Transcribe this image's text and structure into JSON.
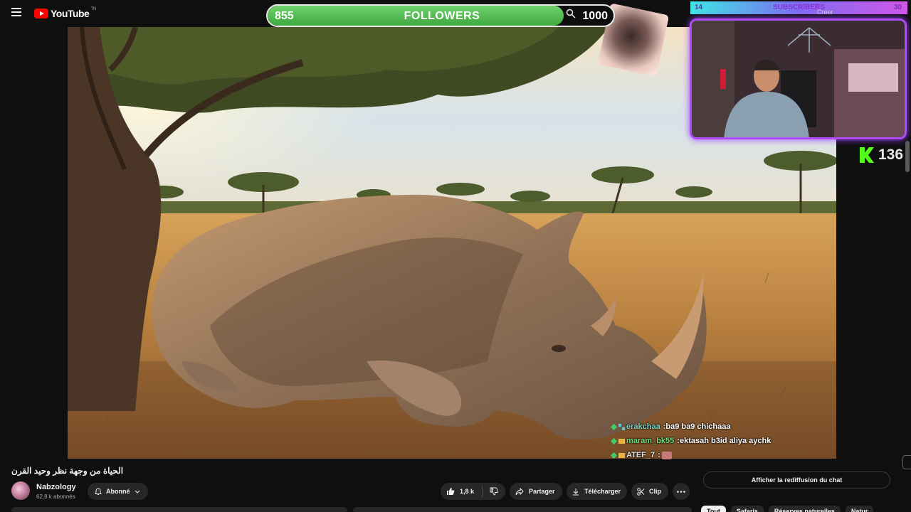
{
  "youtube": {
    "logo_text": "YouTube",
    "logo_tm": "TN"
  },
  "overlays": {
    "followers": {
      "count": "855",
      "label": "FOLLOWERS",
      "goal": "1000",
      "progress": 0.855
    },
    "subscribers": {
      "count": "14",
      "label": "SUBSCRIBERS",
      "goal": "30",
      "creer_label": "Créer"
    },
    "kick": {
      "count": "136"
    },
    "chat": [
      {
        "user": "erakchaa",
        "separator": " : ",
        "message": "ba9 ba9 chichaaa",
        "user_color": "#7fd8c8"
      },
      {
        "user": "maram_bk55",
        "separator": " : ",
        "message": "ektasah b3id aliya aychk",
        "user_color": "#6fe07a"
      },
      {
        "user": "ATEF_7",
        "separator": " : ",
        "message": "",
        "user_color": "#e4e4e4"
      }
    ]
  },
  "video": {
    "title": "الحياة من وجهة نظر وحيد القرن"
  },
  "channel": {
    "name": "Nabzology",
    "subscribers": "62,8 k abonnés",
    "subscribe_label": "Abonné"
  },
  "actions": {
    "like_count": "1,8 k",
    "share": "Partager",
    "download": "Télécharger",
    "clip": "Clip"
  },
  "chat_panel": {
    "replay_label": "Afficher la rediffusion du chat"
  },
  "chips": [
    "Tout",
    "Safaris",
    "Réserves naturelles",
    "Natur"
  ],
  "colors": {
    "accent_red": "#ff0000",
    "followers_green": "#4cbb48",
    "kick_green": "#53fc18",
    "webcam_glow": "#b04bff"
  }
}
